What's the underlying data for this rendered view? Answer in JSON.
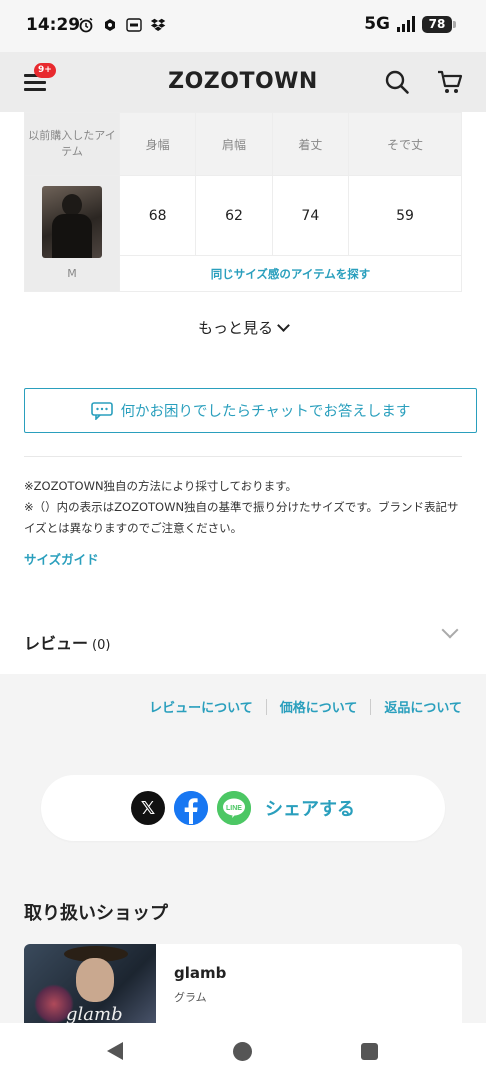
{
  "status_bar": {
    "time": "14:29",
    "network": "5G",
    "battery": "78",
    "icons": [
      "alarm-icon",
      "notification-icon",
      "app-icon",
      "dropbox-icon"
    ]
  },
  "header": {
    "logo": "ZOZOTOWN",
    "menu_badge": "9+",
    "icons": [
      "menu-icon",
      "search-icon",
      "cart-icon"
    ]
  },
  "size_table": {
    "row_label": "以前購入したアイテム",
    "columns": [
      "身幅",
      "肩幅",
      "着丈",
      "そで丈"
    ],
    "item_size": "M",
    "values": [
      "68",
      "62",
      "74",
      "59"
    ],
    "same_size_link": "同じサイズ感のアイテムを探す"
  },
  "more_label": "もっと見る",
  "chat_button": "何かお困りでしたらチャットでお答えします",
  "notes": {
    "line1": "※ZOZOTOWN独自の方法により採寸しております。",
    "line2": "※（）内の表示はZOZOTOWN独自の基準で振り分けたサイズです。ブランド表記サイズとは異なりますのでご注意ください。"
  },
  "size_guide": "サイズガイド",
  "review": {
    "title": "レビュー",
    "count": "(0)"
  },
  "links": [
    "レビューについて",
    "価格について",
    "返品について"
  ],
  "share": {
    "label": "シェアする",
    "buttons": [
      "x-icon",
      "facebook-icon",
      "line-icon"
    ],
    "line_text": "LINE",
    "colors": {
      "x": "#111111",
      "facebook": "#1877f2",
      "line": "#4cc764"
    }
  },
  "shop": {
    "heading": "取り扱いショップ",
    "name": "glamb",
    "kana": "グラム",
    "logo_script": "glamb"
  },
  "nav": [
    "back-icon",
    "home-icon",
    "recent-apps-icon"
  ],
  "colors": {
    "accent": "#2a9fbd",
    "badge": "#e8292e"
  }
}
